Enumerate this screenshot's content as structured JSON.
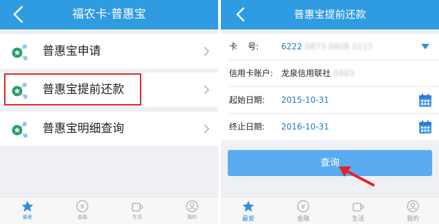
{
  "left": {
    "header_title": "福农卡·普惠宝",
    "menu": [
      {
        "label": "普惠宝申请"
      },
      {
        "label": "普惠宝提前还款"
      },
      {
        "label": "普惠宝明细查询"
      }
    ],
    "tabs": [
      {
        "label": "最爱",
        "icon": "star-icon"
      },
      {
        "label": "金融",
        "icon": "yuan-icon"
      },
      {
        "label": "生活",
        "icon": "cup-icon"
      },
      {
        "label": "我的",
        "icon": "person-icon"
      }
    ]
  },
  "right": {
    "header_title": "普惠宝提前还款",
    "fields": {
      "card_label": "卡    号:",
      "card_value": "6222",
      "card_masked": "0873 8808 0115",
      "account_label": "信用卡账户:",
      "account_value": "龙泉信用联社",
      "account_masked": "0403",
      "start_label": "起始日期:",
      "start_value": "2015-10-31",
      "end_label": "终止日期:",
      "end_value": "2016-10-31"
    },
    "query_label": "查询",
    "tabs": [
      {
        "label": "最爱",
        "icon": "star-icon"
      },
      {
        "label": "金融",
        "icon": "yuan-icon"
      },
      {
        "label": "生活",
        "icon": "cup-icon"
      },
      {
        "label": "我的",
        "icon": "person-icon"
      }
    ]
  },
  "colors": {
    "header": "#2f9be0",
    "button": "#5aaaf0",
    "highlight": "#e02424",
    "value_text": "#1e78c8"
  }
}
